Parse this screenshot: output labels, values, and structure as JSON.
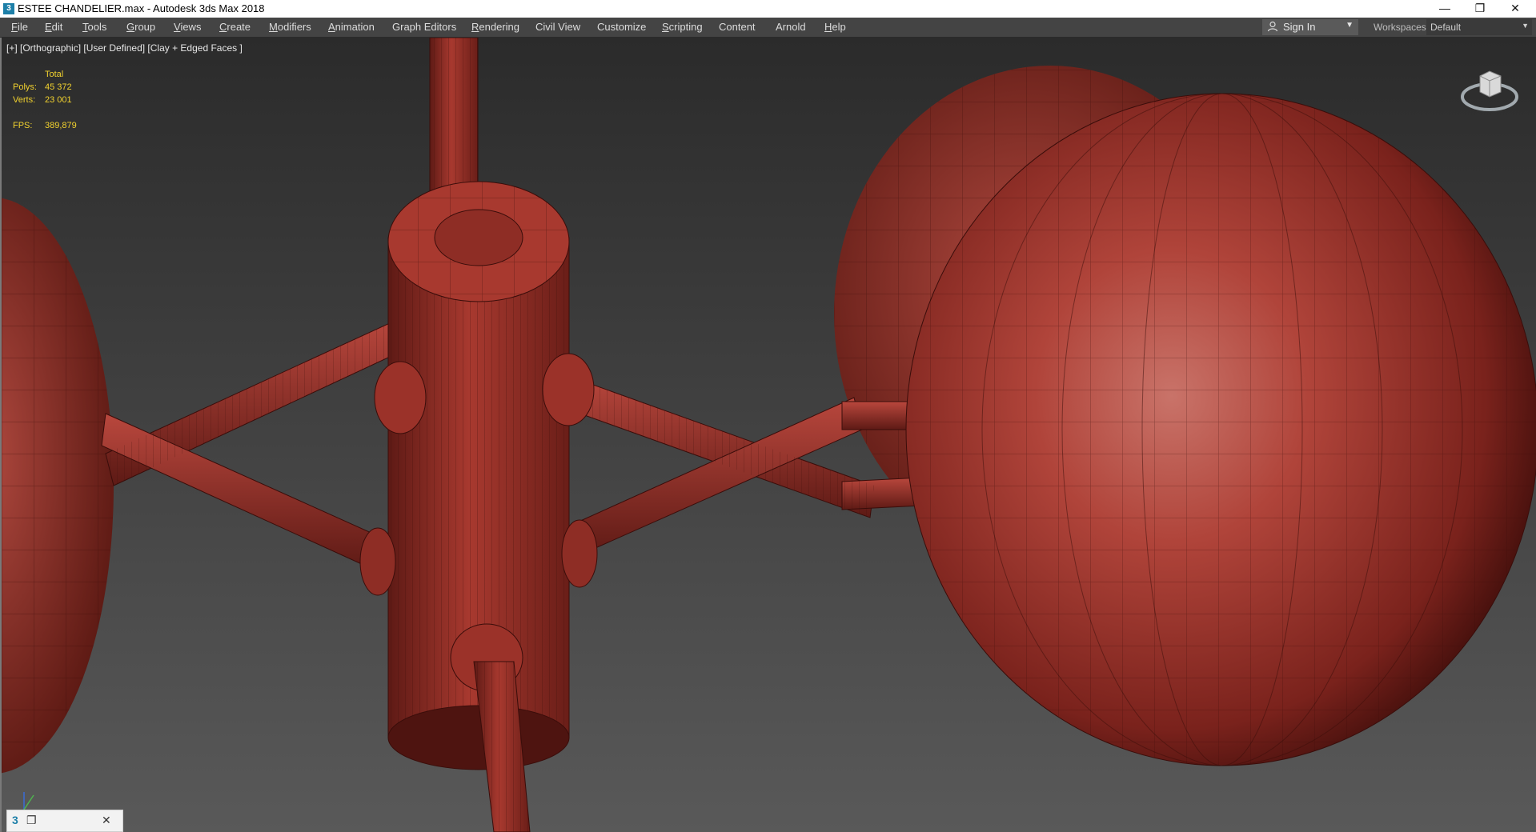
{
  "window": {
    "title": "ESTEE CHANDELIER.max - Autodesk 3ds Max 2018",
    "app_icon_glyph": "3",
    "minimize_glyph": "—",
    "maximize_glyph": "❐",
    "close_glyph": "✕"
  },
  "menu": [
    {
      "label": "File",
      "key": "F"
    },
    {
      "label": "Edit",
      "key": "E"
    },
    {
      "label": "Tools",
      "key": "T"
    },
    {
      "label": "Group",
      "key": "G"
    },
    {
      "label": "Views",
      "key": "V"
    },
    {
      "label": "Create",
      "key": "C"
    },
    {
      "label": "Modifiers",
      "key": "M"
    },
    {
      "label": "Animation",
      "key": "A"
    },
    {
      "label": "Graph Editors",
      "key": ""
    },
    {
      "label": "Rendering",
      "key": "R"
    },
    {
      "label": "Civil View",
      "key": ""
    },
    {
      "label": "Customize",
      "key": ""
    },
    {
      "label": "Scripting",
      "key": "S"
    },
    {
      "label": "Content",
      "key": ""
    },
    {
      "label": "Arnold",
      "key": ""
    },
    {
      "label": "Help",
      "key": "H"
    }
  ],
  "header_right": {
    "sign_in_label": "Sign In",
    "workspaces_label": "Workspaces:",
    "workspace_value": "Default"
  },
  "viewport": {
    "label": "[+] [Orthographic] [User Defined] [Clay + Edged Faces ]",
    "stats": {
      "total_label": "Total",
      "polys_label": "Polys:",
      "polys_value": "45 372",
      "verts_label": "Verts:",
      "verts_value": "23 001",
      "fps_label": "FPS:",
      "fps_value": "389,879"
    }
  },
  "taskbar_thumb": {
    "icon_glyph": "3",
    "restore_glyph": "❐",
    "close_glyph": "✕"
  },
  "colors": {
    "clay": "#b8433a",
    "clay_dark": "#6e1d18",
    "wire": "#3a0d0a",
    "stats_text": "#f2d22e",
    "menubar_bg": "#444444"
  }
}
